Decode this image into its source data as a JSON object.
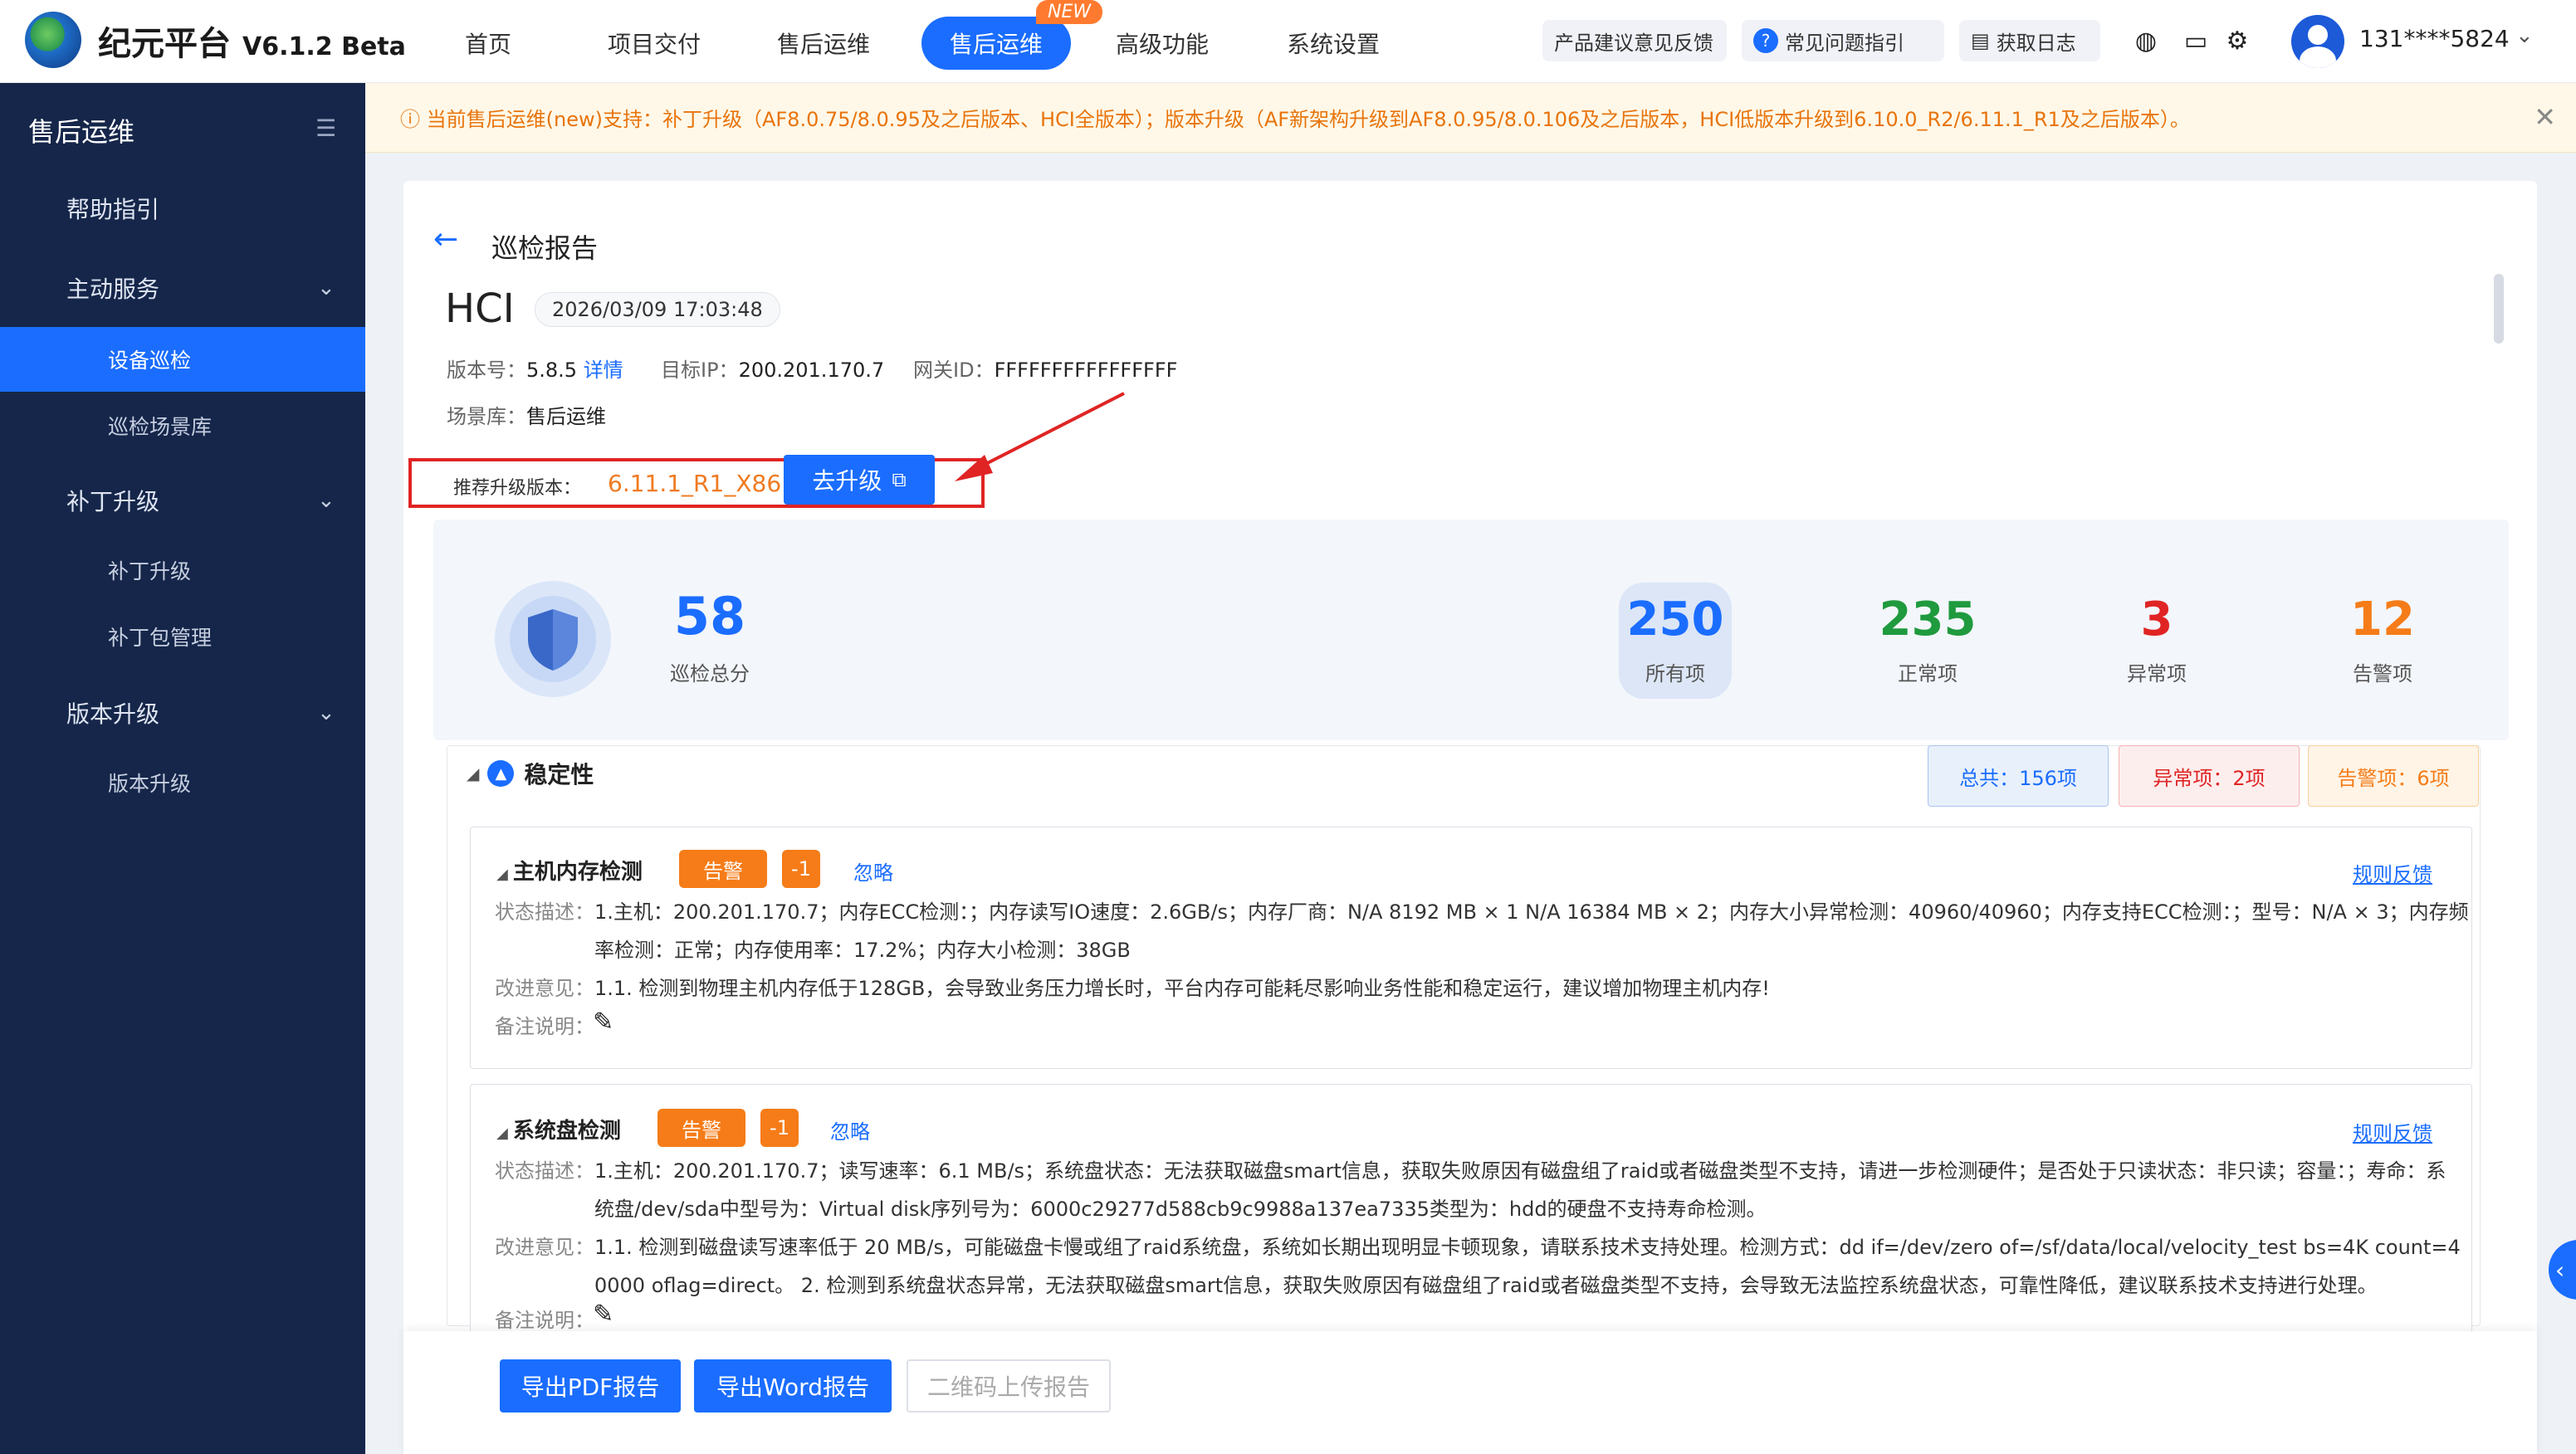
{
  "header": {
    "brand": "纪元平台",
    "version": "V6.1.2 Beta",
    "nav": [
      "首页",
      "项目交付",
      "售后运维",
      "售后运维",
      "高级功能",
      "系统设置"
    ],
    "new_tag": "NEW",
    "feedback": "产品建议意见反馈",
    "faq": "常见问题指引",
    "logs": "获取日志",
    "user": "131****5824"
  },
  "sidebar": {
    "title": "售后运维",
    "items": [
      {
        "label": "帮助指引"
      },
      {
        "label": "主动服务"
      },
      {
        "label": "设备巡检"
      },
      {
        "label": "巡检场景库"
      },
      {
        "label": "补丁升级"
      },
      {
        "label": "补丁升级"
      },
      {
        "label": "补丁包管理"
      },
      {
        "label": "版本升级"
      },
      {
        "label": "版本升级"
      }
    ]
  },
  "notice": "ⓘ 当前售后运维(new)支持：补丁升级（AF8.0.75/8.0.95及之后版本、HCI全版本）；版本升级（AF新架构升级到AF8.0.95/8.0.106及之后版本，HCI低版本升级到6.10.0_R2/6.11.1_R1及之后版本）。",
  "report": {
    "page_title": "巡检报告",
    "product": "HCI",
    "date": "2026/03/09 17:03:48",
    "version_label": "版本号：",
    "version": "5.8.5",
    "detail": "详情",
    "target_label": "目标IP：",
    "target_ip": "200.201.170.7",
    "gateway_label": "网关ID：",
    "gateway_id": "FFFFFFFFFFFFFFFF",
    "scene_label": "场景库：",
    "scene": "售后运维",
    "recommend_label": "推荐升级版本：",
    "recommend_version": "6.11.1_R1_X86",
    "upgrade_btn": "去升级"
  },
  "score": {
    "total": "58",
    "total_label": "巡检总分",
    "all": "250",
    "all_label": "所有项",
    "normal": "235",
    "normal_label": "正常项",
    "abnormal": "3",
    "abnormal_label": "异常项",
    "warn": "12",
    "warn_label": "告警项"
  },
  "section": {
    "title": "稳定性",
    "total": "总共：156项",
    "abnormal": "异常项：2项",
    "warn": "告警项：6项"
  },
  "cards": [
    {
      "title": "主机内存检测",
      "tag": "告警",
      "delta": "-1",
      "ignore": "忽略",
      "rule": "规则反馈",
      "status_label": "状态描述：",
      "status_1": "1.主机：200.201.170.7；内存ECC检测：；内存读写IO速度：2.6GB/s；内存厂商：N/A 8192 MB × 1 N/A 16384 MB × 2；内存大小异常检测：40960/40960；内存支持ECC检测：；型号：N/A × 3；内存频",
      "status_2": "率检测：正常；内存使用率：17.2%；内存大小检测：38GB",
      "advice_label": "改进意见：",
      "advice_1": "1.1. 检测到物理主机内存低于128GB，会导致业务压力增长时，平台内存可能耗尽影响业务性能和稳定运行，建议增加物理主机内存!",
      "remark_label": "备注说明："
    },
    {
      "title": "系统盘检测",
      "tag": "告警",
      "delta": "-1",
      "ignore": "忽略",
      "rule": "规则反馈",
      "status_label": "状态描述：",
      "status_1": "1.主机：200.201.170.7；读写速率：6.1 MB/s；系统盘状态：无法获取磁盘smart信息，获取失败原因有磁盘组了raid或者磁盘类型不支持，请进一步检测硬件；是否处于只读状态：非只读；容量：；寿命：系",
      "status_2": "统盘/dev/sda中型号为：Virtual disk序列号为：6000c29277d588cb9c9988a137ea7335类型为：hdd的硬盘不支持寿命检测。",
      "advice_label": "改进意见：",
      "advice_1": "1.1. 检测到磁盘读写速率低于 20 MB/s，可能磁盘卡慢或组了raid系统盘，系统如长期出现明显卡顿现象，请联系技术支持处理。检测方式：dd if=/dev/zero of=/sf/data/local/velocity_test bs=4K count=4",
      "advice_2": "0000 oflag=direct。 2. 检测到系统盘状态异常，无法获取磁盘smart信息，获取失败原因有磁盘组了raid或者磁盘类型不支持，会导致无法监控系统盘状态，可靠性降低，建议联系技术支持进行处理。",
      "remark_label": "备注说明："
    }
  ],
  "footer": {
    "pdf": "导出PDF报告",
    "word": "导出Word报告",
    "qr": "二维码上传报告"
  },
  "colors": {
    "accent": "#1a6dff",
    "sidebar": "#15264a",
    "warn": "#f57c18",
    "normal": "#1f9a3e",
    "abnormal": "#e02424"
  }
}
